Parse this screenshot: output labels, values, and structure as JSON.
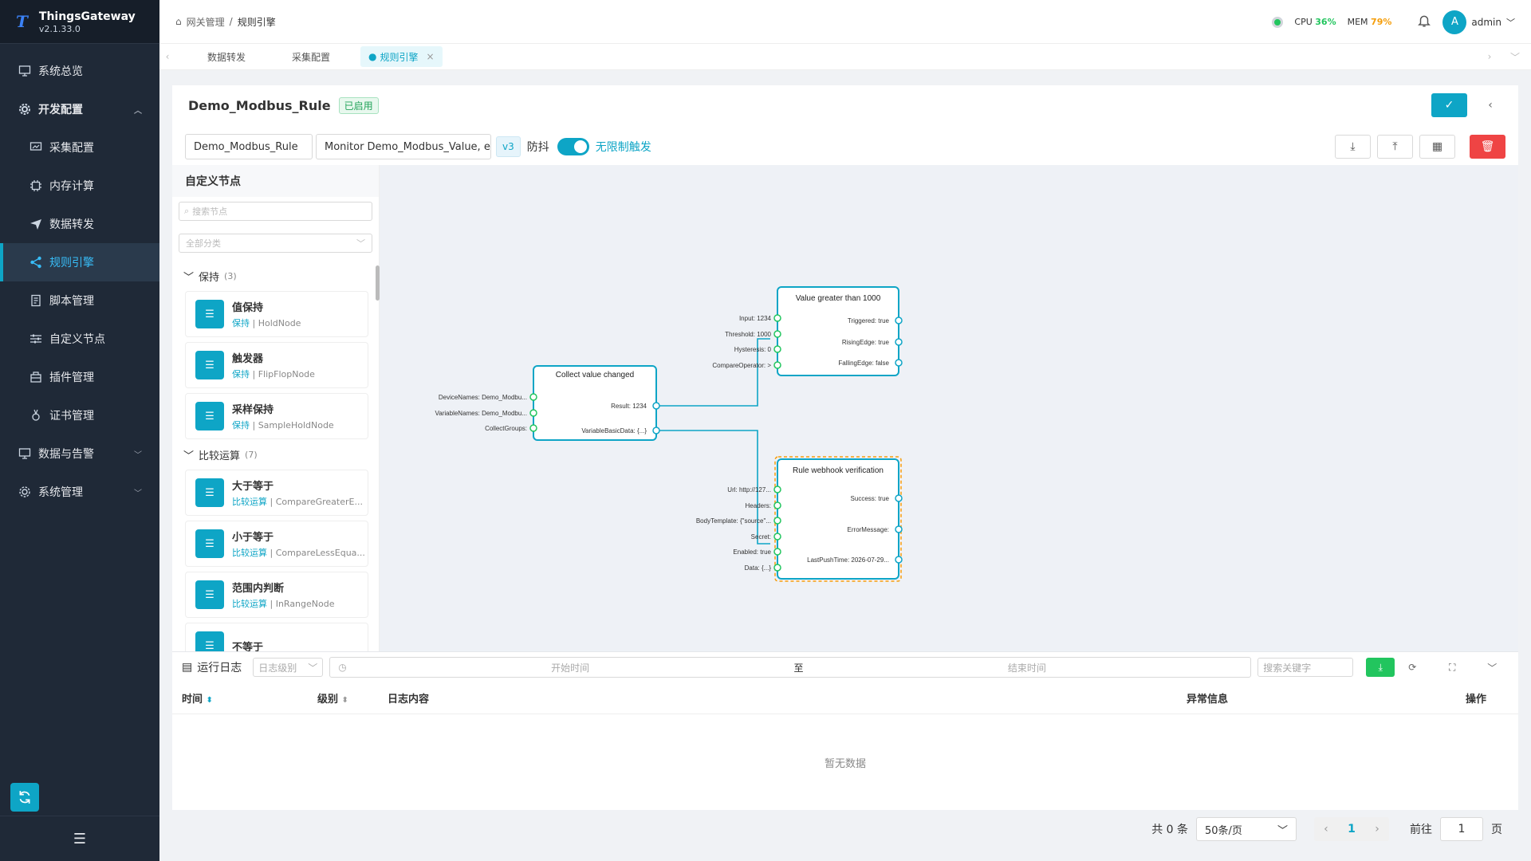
{
  "app": {
    "name": "ThingsGateway",
    "version": "v2.1.33.0"
  },
  "sidebar": {
    "items": [
      {
        "label": "系统总览",
        "icon": "monitor-icon"
      },
      {
        "label": "开发配置",
        "icon": "gear-icon"
      },
      {
        "label": "采集配置",
        "icon": "collect-icon"
      },
      {
        "label": "内存计算",
        "icon": "chip-icon"
      },
      {
        "label": "数据转发",
        "icon": "send-icon"
      },
      {
        "label": "规则引擎",
        "icon": "share-icon"
      },
      {
        "label": "脚本管理",
        "icon": "doc-icon"
      },
      {
        "label": "自定义节点",
        "icon": "sliders-icon"
      },
      {
        "label": "插件管理",
        "icon": "plugin-icon"
      },
      {
        "label": "证书管理",
        "icon": "cert-icon"
      },
      {
        "label": "数据与告警",
        "icon": "monitor-icon"
      },
      {
        "label": "系统管理",
        "icon": "gear-icon"
      }
    ]
  },
  "header": {
    "breadcrumb": [
      "网关管理",
      "规则引擎"
    ],
    "cpu_label": "CPU",
    "cpu_value": "36%",
    "mem_label": "MEM",
    "mem_value": "79%",
    "user": "admin",
    "avatar_letter": "A"
  },
  "tabs": [
    "数据转发",
    "采集配置",
    "规则引擎"
  ],
  "rule": {
    "title": "Demo_Modbus_Rule",
    "status": "已启用",
    "name_value": "Demo_Modbus_Rule",
    "desc_value": "Monitor Demo_Modbus_Value, eva",
    "version": "v3",
    "debounce_label": "防抖",
    "unlimited_label": "无限制触发"
  },
  "node_panel": {
    "title": "自定义节点",
    "search_placeholder": "搜索节点",
    "category_placeholder": "全部分类",
    "groups": [
      {
        "name": "保持",
        "count": "(3)",
        "nodes": [
          {
            "name": "值保持",
            "cat": "保持",
            "type": "HoldNode"
          },
          {
            "name": "触发器",
            "cat": "保持",
            "type": "FlipFlopNode"
          },
          {
            "name": "采样保持",
            "cat": "保持",
            "type": "SampleHoldNode"
          }
        ]
      },
      {
        "name": "比较运算",
        "count": "(7)",
        "nodes": [
          {
            "name": "大于等于",
            "cat": "比较运算",
            "type": "CompareGreaterE..."
          },
          {
            "name": "小于等于",
            "cat": "比较运算",
            "type": "CompareLessEqua..."
          },
          {
            "name": "范围内判断",
            "cat": "比较运算",
            "type": "InRangeNode"
          },
          {
            "name": "不等于",
            "cat": "",
            "type": ""
          }
        ]
      }
    ]
  },
  "flow": {
    "nodes": [
      {
        "title": "Collect value changed",
        "inputs": [
          "DeviceNames: Demo_Modbu...",
          "VariableNames: Demo_Modbu...",
          "CollectGroups:"
        ],
        "outputs": [
          "Result: 1234",
          "VariableBasicData: {...}"
        ]
      },
      {
        "title": "Value greater than 1000",
        "inputs": [
          "Input: 1234",
          "Threshold: 1000",
          "Hysteresis: 0",
          "CompareOperator: >"
        ],
        "outputs": [
          "Triggered: true",
          "RisingEdge: true",
          "FallingEdge: false"
        ]
      },
      {
        "title": "Rule webhook verification",
        "inputs": [
          "Url: http://127...",
          "Headers:",
          "BodyTemplate: {\"source\"...",
          "Secret:",
          "Enabled: true",
          "Data: {...}"
        ],
        "outputs": [
          "Success: true",
          "ErrorMessage:",
          "LastPushTime: 2026-07-29..."
        ]
      }
    ]
  },
  "logs": {
    "title": "运行日志",
    "level_placeholder": "日志级别",
    "start_placeholder": "开始时间",
    "to": "至",
    "end_placeholder": "结束时间",
    "keyword_placeholder": "搜索关键字",
    "columns": [
      "时间",
      "级别",
      "日志内容",
      "异常信息",
      "操作"
    ],
    "empty": "暂无数据"
  },
  "pager": {
    "total": "共 0 条",
    "page_size": "50条/页",
    "current": "1",
    "goto_label": "前往",
    "goto_value": "1",
    "page_unit": "页"
  }
}
